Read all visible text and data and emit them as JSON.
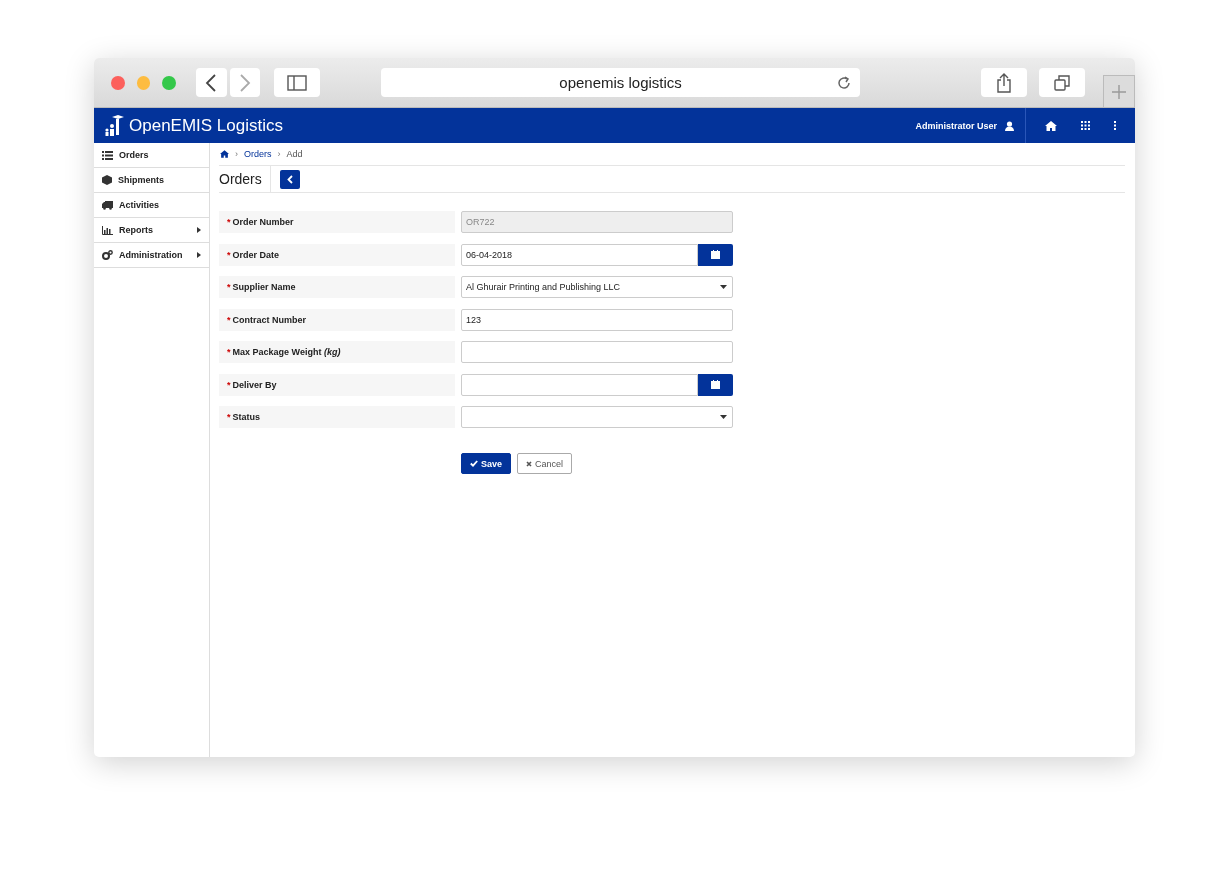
{
  "browser": {
    "address": "openemis logistics"
  },
  "header": {
    "brand": "OpenEMIS Logistics",
    "user": "Administrator User"
  },
  "sidebar": {
    "items": [
      {
        "label": "Orders",
        "has_submenu": false
      },
      {
        "label": "Shipments",
        "has_submenu": false
      },
      {
        "label": "Activities",
        "has_submenu": false
      },
      {
        "label": "Reports",
        "has_submenu": true
      },
      {
        "label": "Administration",
        "has_submenu": true
      }
    ]
  },
  "breadcrumb": {
    "items": [
      {
        "separator": "›",
        "label": "Orders",
        "link": true
      },
      {
        "separator": "›",
        "label": "Add",
        "link": false
      }
    ]
  },
  "page_title": "Orders",
  "form": {
    "fields": [
      {
        "required_mark": "*",
        "label": "Order Number",
        "kind": "text",
        "value": "OR722",
        "disabled": true
      },
      {
        "required_mark": "*",
        "label": "Order Date",
        "kind": "date",
        "value": "06-04-2018",
        "disabled": false
      },
      {
        "required_mark": "*",
        "label": "Supplier Name",
        "kind": "select",
        "value": "Al Ghurair Printing and Publishing LLC",
        "disabled": false
      },
      {
        "required_mark": "*",
        "label": "Contract Number",
        "kind": "text",
        "value": "123",
        "disabled": false
      },
      {
        "required_mark": "*",
        "label": "Max Package Weight *(kg)*",
        "kind": "text",
        "disabled": false
      },
      {
        "required_mark": "*",
        "label": "Deliver By",
        "kind": "date",
        "disabled": false
      },
      {
        "required_mark": "*",
        "label": "Status",
        "kind": "select",
        "disabled": false
      }
    ],
    "buttons": [
      {
        "label": "Save",
        "kind": "primary"
      },
      {
        "label": "Cancel",
        "kind": "cancel"
      }
    ]
  }
}
